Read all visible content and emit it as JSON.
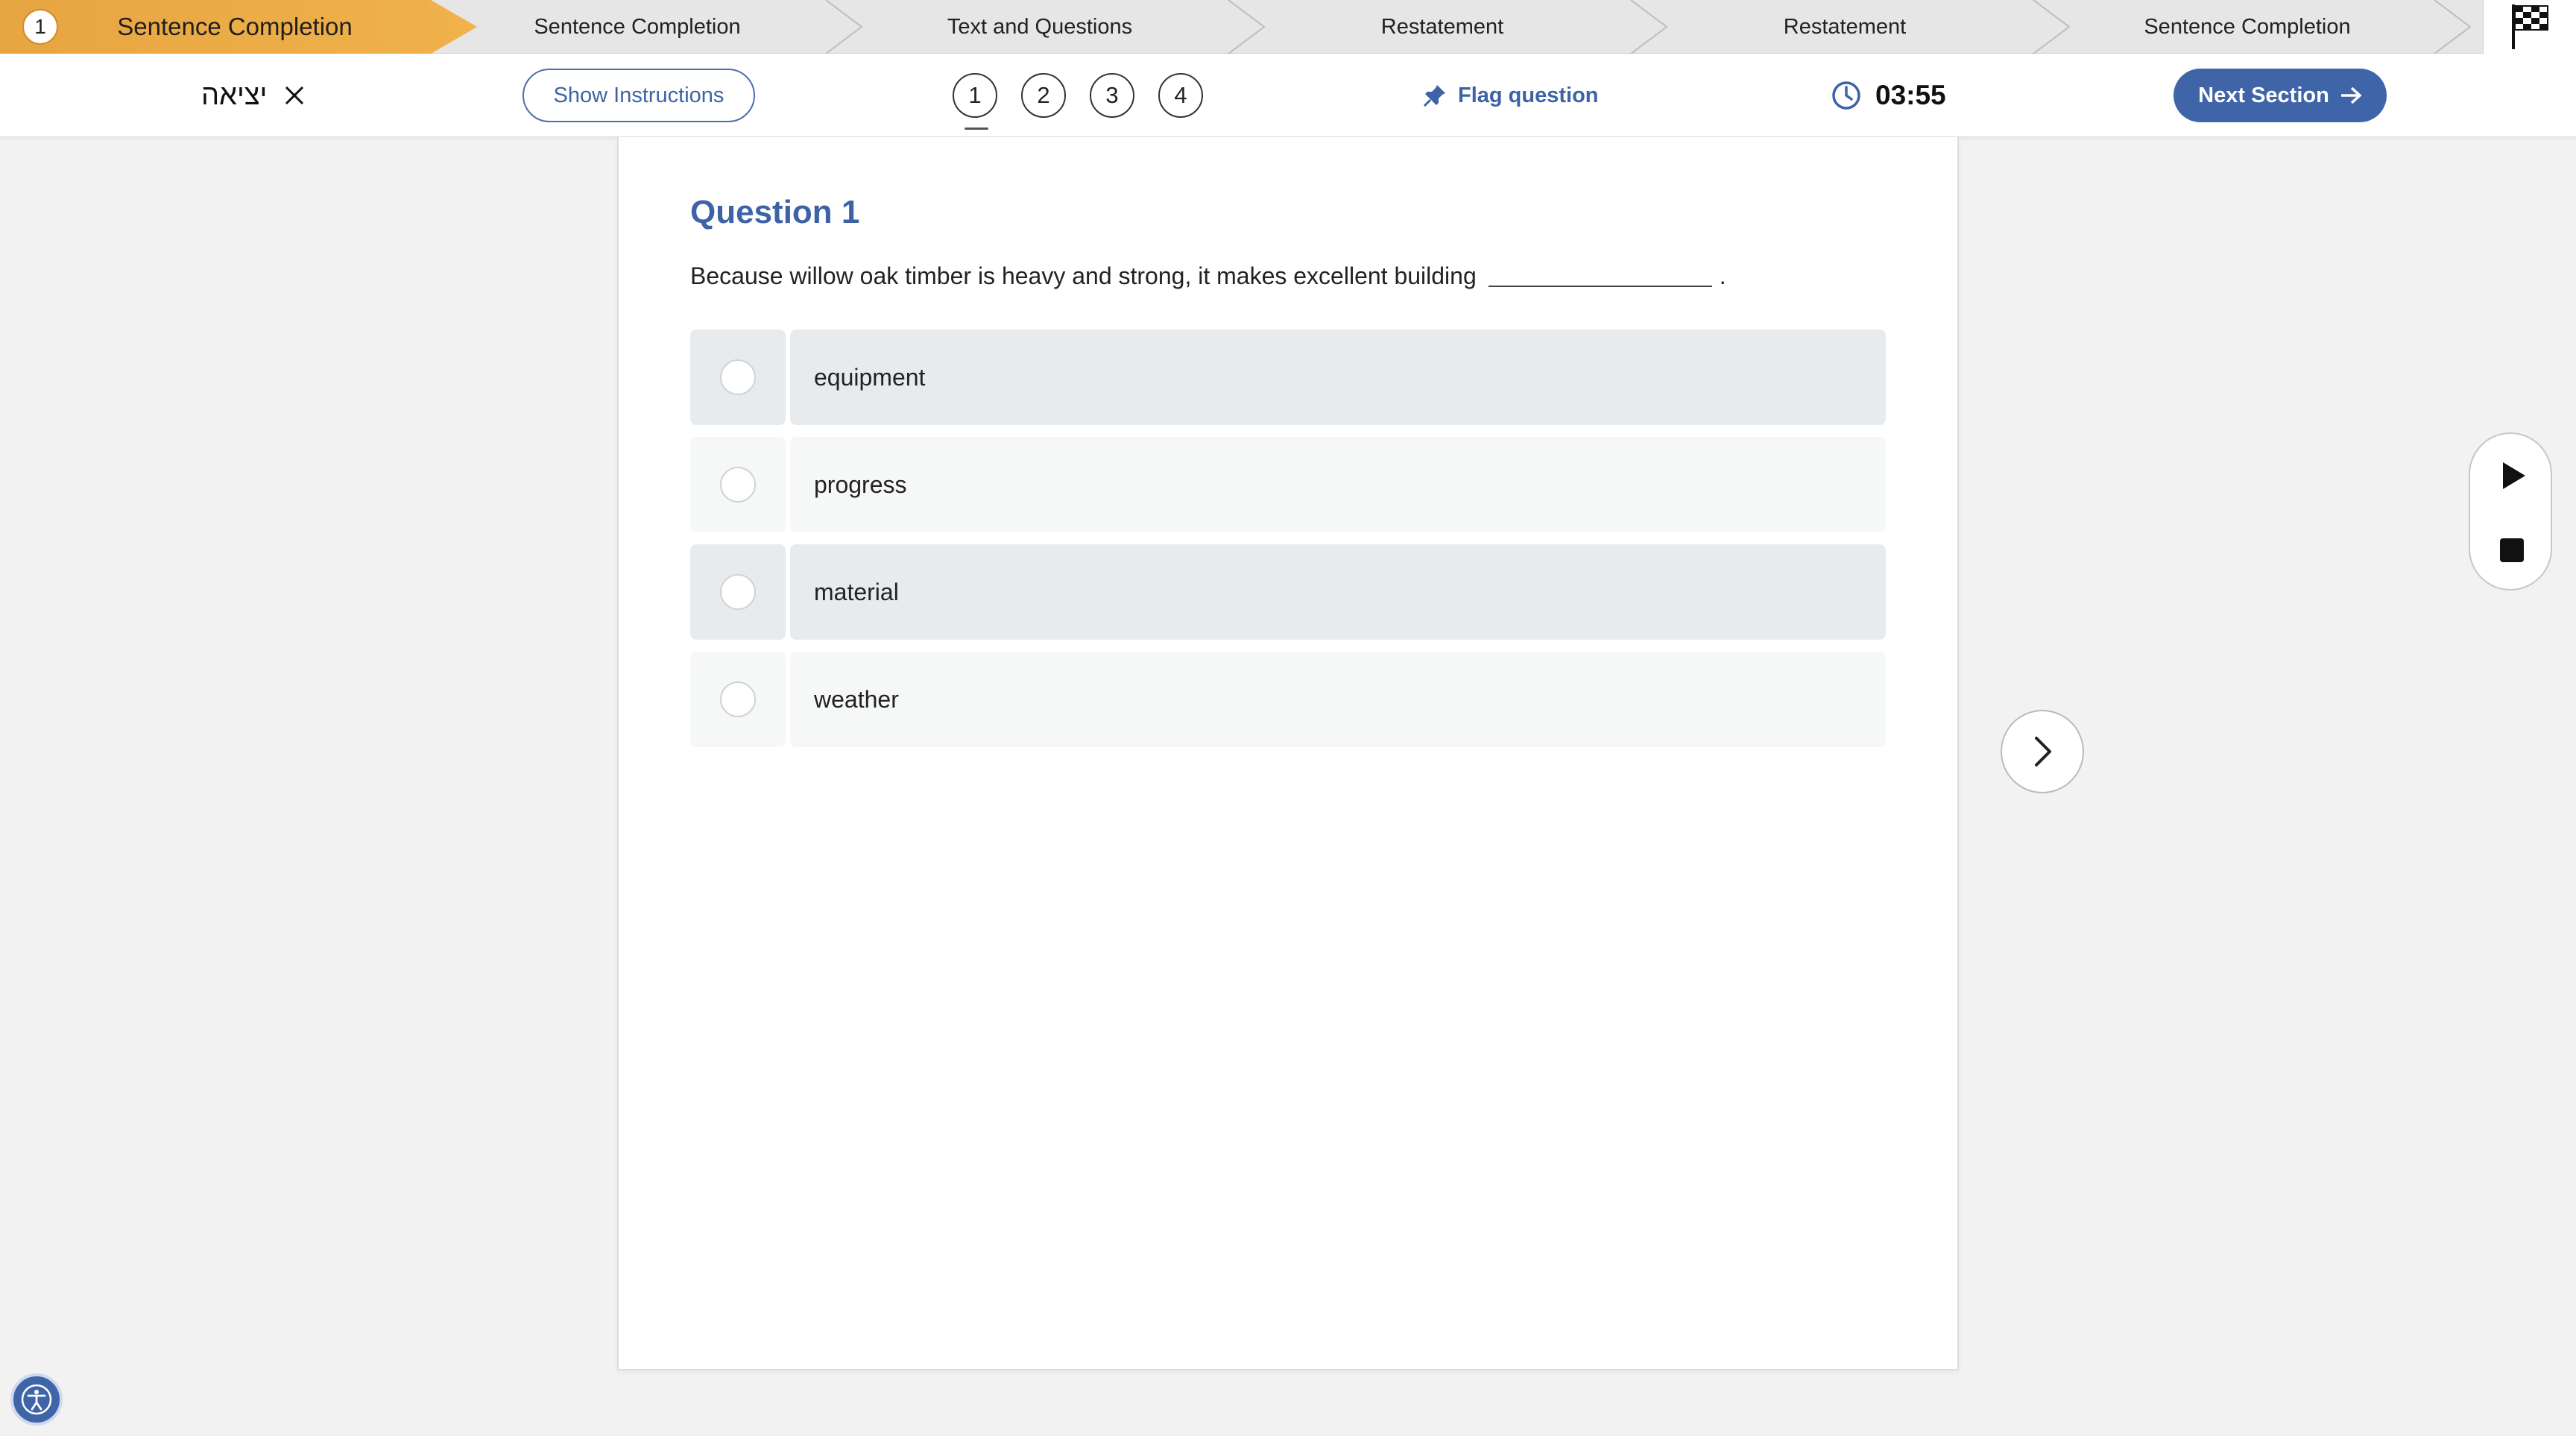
{
  "sections": {
    "active_number": "1",
    "items": [
      {
        "label": "Sentence Completion"
      },
      {
        "label": "Sentence Completion"
      },
      {
        "label": "Text and Questions"
      },
      {
        "label": "Restatement"
      },
      {
        "label": "Restatement"
      },
      {
        "label": "Sentence Completion"
      }
    ]
  },
  "toolbar": {
    "exit_label": "יציאה",
    "show_instructions": "Show Instructions",
    "question_numbers": [
      "1",
      "2",
      "3",
      "4"
    ],
    "flag_label": "Flag question",
    "timer": "03:55",
    "next_section": "Next Section"
  },
  "question": {
    "title": "Question 1",
    "text": "Because willow oak timber is heavy and strong, it makes excellent building",
    "end": ".",
    "options": [
      "equipment",
      "progress",
      "material",
      "weather"
    ]
  },
  "colors": {
    "accent": "#3f64a8",
    "section_active": "#f0b24a"
  },
  "icons": [
    "close-icon",
    "pin-icon",
    "clock-icon",
    "arrow-right-icon",
    "chevron-right-icon",
    "play-icon",
    "stop-icon",
    "checkered-flag-icon",
    "accessibility-icon"
  ]
}
